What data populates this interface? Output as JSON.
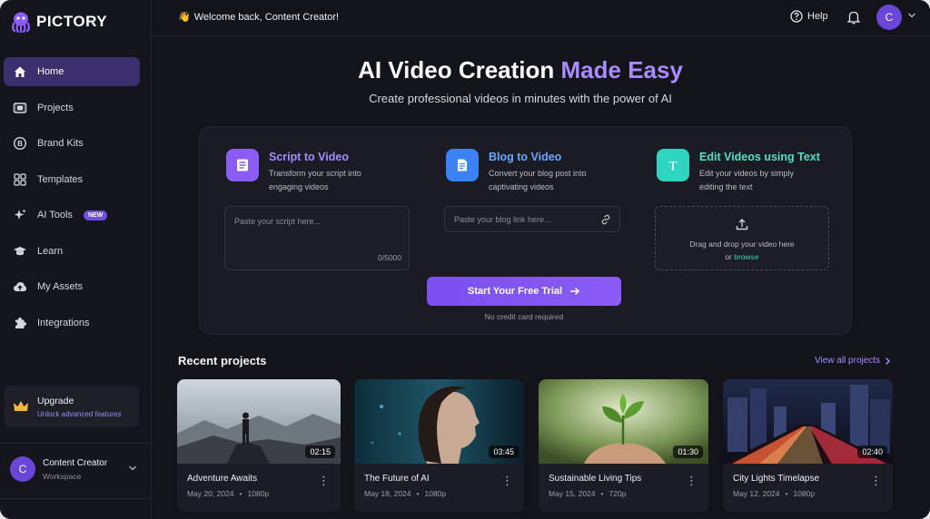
{
  "brand": {
    "name": "PICTORY",
    "accent": "#8b5cf6"
  },
  "sidebar": {
    "items": [
      {
        "label": "Home",
        "icon": "home-icon",
        "active": true
      },
      {
        "label": "Projects",
        "icon": "film-icon"
      },
      {
        "label": "Brand Kits",
        "icon": "brand-icon"
      },
      {
        "label": "Templates",
        "icon": "grid-icon"
      },
      {
        "label": "AI Tools",
        "icon": "sparkle-icon",
        "badge": "NEW"
      },
      {
        "label": "Learn",
        "icon": "graduation-cap-icon"
      },
      {
        "label": "My Assets",
        "icon": "cloud-upload-icon"
      },
      {
        "label": "Integrations",
        "icon": "puzzle-icon"
      }
    ],
    "upgrade": {
      "title": "Upgrade",
      "subtitle": "Unlock advanced features"
    },
    "user": {
      "initial": "C",
      "name": "Content Creator",
      "workspace": "Workspace"
    }
  },
  "topbar": {
    "welcome": "Welcome back, Content Creator!",
    "wave": "👋",
    "help": "Help",
    "avatar_initial": "C"
  },
  "hero": {
    "title_main": "AI Video Creation ",
    "title_accent": "Made Easy",
    "subtitle": "Create professional videos in minutes with the power of AI"
  },
  "cards": {
    "script": {
      "title": "Script to Video",
      "desc": "Transform your script into engaging videos",
      "placeholder": "Paste your script here...",
      "counter": "0/5000",
      "color": "#8b5cf6"
    },
    "blog": {
      "title": "Blog to Video",
      "desc": "Convert your blog post into captivating videos",
      "placeholder": "Paste your blog link here...",
      "color": "#3b82f6"
    },
    "edit": {
      "title": "Edit Videos using Text",
      "desc": "Edit your videos by simply editing the text",
      "drop_text": "Drag and drop your video here",
      "or": "or",
      "browse": "browse",
      "color": "#2dd4bf"
    }
  },
  "cta": {
    "label": "Start Your Free Trial",
    "note": "No credit card required"
  },
  "recent": {
    "title": "Recent projects",
    "view_all": "View all projects",
    "projects": [
      {
        "name": "Adventure Awaits",
        "date": "May 20, 2024",
        "quality": "1080p",
        "duration": "02:15"
      },
      {
        "name": "The Future of AI",
        "date": "May 18, 2024",
        "quality": "1080p",
        "duration": "03:45"
      },
      {
        "name": "Sustainable Living Tips",
        "date": "May 15, 2024",
        "quality": "720p",
        "duration": "01:30"
      },
      {
        "name": "City Lights Timelapse",
        "date": "May 12, 2024",
        "quality": "1080p",
        "duration": "02:40"
      }
    ]
  }
}
